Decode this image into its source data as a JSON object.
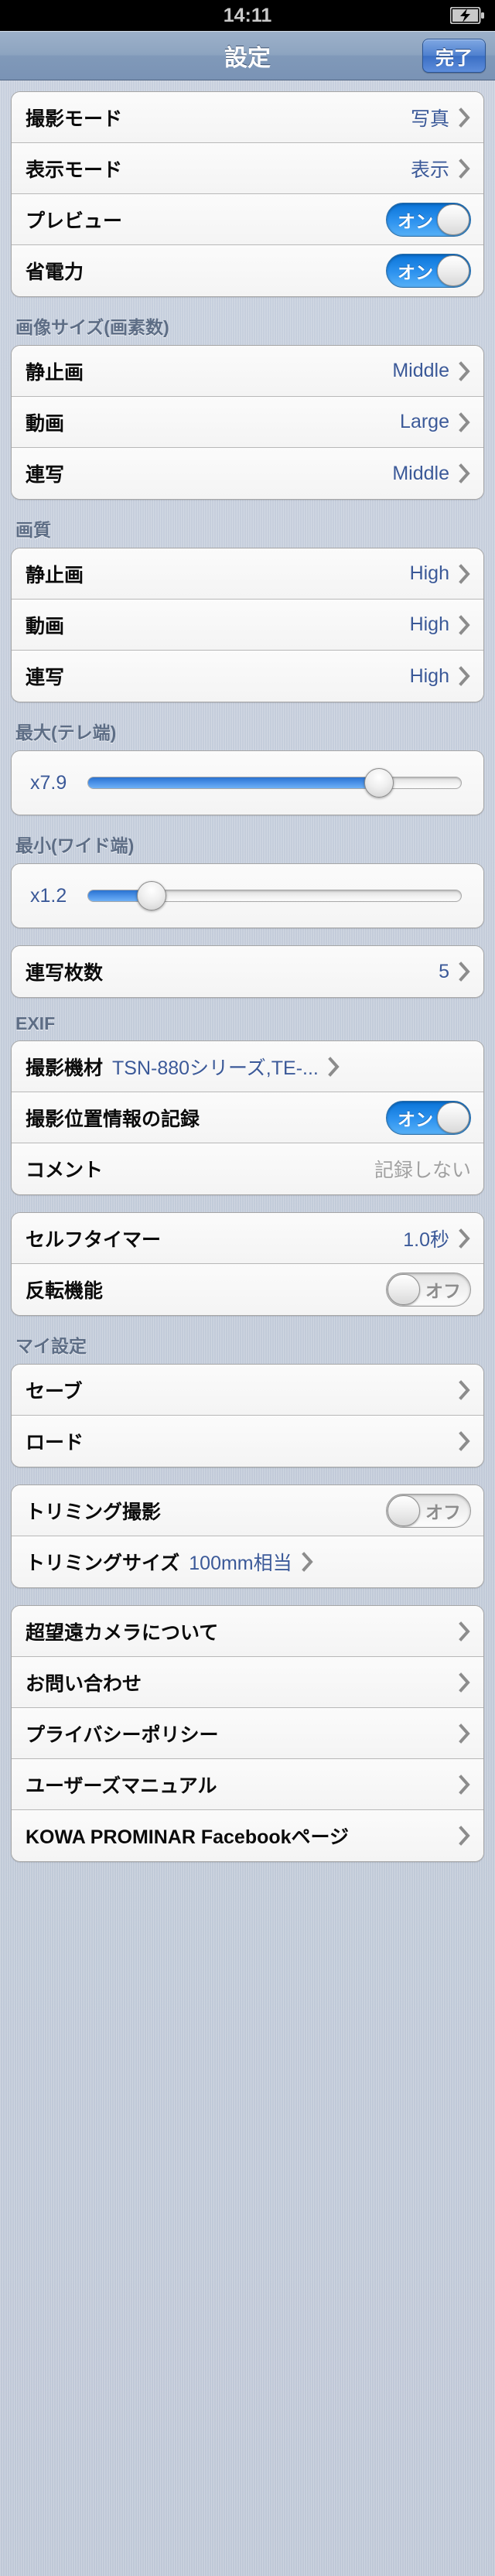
{
  "status_bar": {
    "time": "14:11",
    "battery_icon": "battery-charging-icon"
  },
  "nav": {
    "title": "設定",
    "done_label": "完了"
  },
  "sections": [
    {
      "header": "",
      "rows": [
        {
          "type": "disclosure",
          "label": "撮影モード",
          "value": "写真"
        },
        {
          "type": "disclosure",
          "label": "表示モード",
          "value": "表示"
        },
        {
          "type": "toggle",
          "label": "プレビュー",
          "state": "on",
          "state_label": "オン"
        },
        {
          "type": "toggle",
          "label": "省電力",
          "state": "on",
          "state_label": "オン"
        }
      ]
    },
    {
      "header": "画像サイズ(画素数)",
      "rows": [
        {
          "type": "disclosure",
          "label": "静止画",
          "value": "Middle"
        },
        {
          "type": "disclosure",
          "label": "動画",
          "value": "Large"
        },
        {
          "type": "disclosure",
          "label": "連写",
          "value": "Middle"
        }
      ]
    },
    {
      "header": "画質",
      "rows": [
        {
          "type": "disclosure",
          "label": "静止画",
          "value": "High"
        },
        {
          "type": "disclosure",
          "label": "動画",
          "value": "High"
        },
        {
          "type": "disclosure",
          "label": "連写",
          "value": "High"
        }
      ]
    },
    {
      "header": "最大(テレ端)",
      "rows": [
        {
          "type": "slider",
          "value": "x7.9",
          "percent": 78
        }
      ]
    },
    {
      "header": "最小(ワイド端)",
      "rows": [
        {
          "type": "slider",
          "value": "x1.2",
          "percent": 17
        }
      ]
    },
    {
      "header": "",
      "rows": [
        {
          "type": "disclosure",
          "label": "連写枚数",
          "value": "5"
        }
      ]
    },
    {
      "header": "EXIF",
      "rows": [
        {
          "type": "disclosure-inline",
          "label": "撮影機材",
          "value": "TSN-880シリーズ,TE-..."
        },
        {
          "type": "toggle",
          "label": "撮影位置情報の記録",
          "state": "on",
          "state_label": "オン"
        },
        {
          "type": "plain",
          "label": "コメント",
          "value": "記録しない",
          "muted": true
        }
      ]
    },
    {
      "header": "",
      "rows": [
        {
          "type": "disclosure",
          "label": "セルフタイマー",
          "value": "1.0秒"
        },
        {
          "type": "toggle",
          "label": "反転機能",
          "state": "off",
          "state_label": "オフ"
        }
      ]
    },
    {
      "header": "マイ設定",
      "rows": [
        {
          "type": "disclosure",
          "label": "セーブ",
          "value": ""
        },
        {
          "type": "disclosure",
          "label": "ロード",
          "value": ""
        }
      ]
    },
    {
      "header": "",
      "rows": [
        {
          "type": "toggle",
          "label": "トリミング撮影",
          "state": "off",
          "state_label": "オフ"
        },
        {
          "type": "disclosure-inline",
          "label": "トリミングサイズ",
          "value": "100mm相当"
        }
      ]
    },
    {
      "header": "",
      "rows": [
        {
          "type": "disclosure",
          "label": "超望遠カメラについて",
          "value": ""
        },
        {
          "type": "disclosure",
          "label": "お問い合わせ",
          "value": ""
        },
        {
          "type": "disclosure",
          "label": "プライバシーポリシー",
          "value": ""
        },
        {
          "type": "disclosure",
          "label": "ユーザーズマニュアル",
          "value": ""
        },
        {
          "type": "disclosure",
          "label": "KOWA PROMINAR Facebookページ",
          "value": ""
        }
      ]
    }
  ],
  "colors": {
    "accent_blue": "#3b5998",
    "toggle_on": "#2e93ef",
    "nav_bar": "#8099b9",
    "background": "#c2cbd9"
  }
}
